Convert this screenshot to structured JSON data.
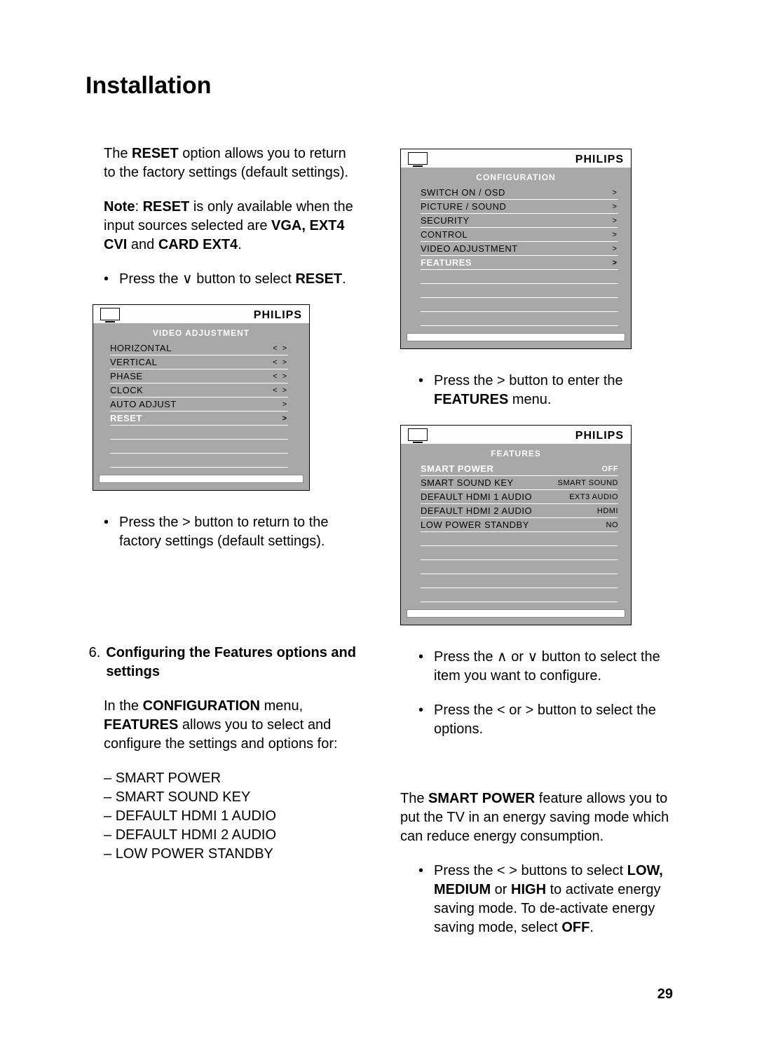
{
  "title": "Installation",
  "page_number": "29",
  "left": {
    "p1_a": "The ",
    "p1_b": "RESET",
    "p1_c": " option allows you to return to the factory settings (default settings).",
    "p2_a": "Note",
    "p2_b": ": ",
    "p2_c": "RESET",
    "p2_d": " is only available when the input sources selected are ",
    "p2_e": "VGA, EXT4 CVI",
    "p2_f": " and ",
    "p2_g": "CARD EXT4",
    "p2_h": ".",
    "b1_a": "Press the ",
    "b1_arrow": "∨",
    "b1_b": " button to select ",
    "b1_c": "RESET",
    "b1_d": ".",
    "ss1": {
      "brand": "PHILIPS",
      "title": "VIDEO ADJUSTMENT",
      "rows": [
        {
          "l": "HORIZONTAL",
          "r": "<  >"
        },
        {
          "l": "VERTICAL",
          "r": "<  >"
        },
        {
          "l": "PHASE",
          "r": "<  >"
        },
        {
          "l": "CLOCK",
          "r": "<  >"
        },
        {
          "l": "AUTO ADJUST",
          "r": ">"
        },
        {
          "l": "RESET",
          "r": ">",
          "sel": true
        }
      ]
    },
    "b2_a": "Press the  ",
    "b2_arrow": ">",
    "b2_b": "  button to return to the factory settings (default settings).",
    "step6_num": "6.",
    "step6_title": "Configuring the Features options and settings",
    "p3_a": "In the ",
    "p3_b": "CONFIGURATION",
    "p3_c": " menu, ",
    "p3_d": "FEATURES",
    "p3_e": " allows you to select and configure the settings and options for:",
    "dash": [
      "SMART POWER",
      "SMART SOUND KEY",
      "DEFAULT HDMI 1 AUDIO",
      "DEFAULT HDMI 2 AUDIO",
      "LOW POWER STANDBY"
    ]
  },
  "right": {
    "ss2": {
      "brand": "PHILIPS",
      "title": "CONFIGURATION",
      "rows": [
        {
          "l": "SWITCH ON   /   OSD",
          "r": ">"
        },
        {
          "l": "PICTURE   /   SOUND",
          "r": ">"
        },
        {
          "l": "SECURITY",
          "r": ">"
        },
        {
          "l": "CONTROL",
          "r": ">"
        },
        {
          "l": "VIDEO  ADJUSTMENT",
          "r": ">"
        },
        {
          "l": "FEATURES",
          "r": ">",
          "sel": true
        }
      ]
    },
    "b3_a": "Press the  ",
    "b3_arrow": ">",
    "b3_b": "  button to enter the ",
    "b3_c": "FEATURES",
    "b3_d": " menu.",
    "ss3": {
      "brand": "PHILIPS",
      "title": "FEATURES",
      "rows": [
        {
          "l": "SMART POWER",
          "v": "OFF",
          "sel": true
        },
        {
          "l": "SMART SOUND KEY",
          "v": "SMART SOUND"
        },
        {
          "l": "DEFAULT HDMI 1 AUDIO",
          "v": "EXT3 AUDIO"
        },
        {
          "l": "DEFAULT HDMI 2 AUDIO",
          "v": "HDMI"
        },
        {
          "l": "LOW POWER STANDBY",
          "v": "NO"
        }
      ]
    },
    "b4_a": "Press the  ",
    "b4_up": "∧",
    "b4_b": " or ",
    "b4_dn": "∨",
    "b4_c": " button to select the item you want to configure.",
    "b5_a": "Press the  ",
    "b5_l": "<",
    "b5_b": "  or ",
    "b5_r": ">",
    "b5_c": "  button to select the options.",
    "p4_a": "The ",
    "p4_b": "SMART POWER",
    "p4_c": " feature allows you to put the TV in an energy saving mode which can reduce energy consumption.",
    "b6_a": "Press the  ",
    "b6_l": "<",
    "b6_sp": "  ",
    "b6_r": ">",
    "b6_b": "  buttons to select ",
    "b6_c": "LOW, MEDIUM",
    "b6_d": " or ",
    "b6_e": "HIGH",
    "b6_f": " to activate energy saving mode. To de-activate energy saving mode, select ",
    "b6_g": "OFF",
    "b6_h": "."
  }
}
